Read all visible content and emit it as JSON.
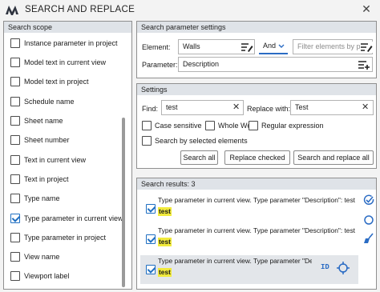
{
  "window": {
    "title": "SEARCH AND REPLACE",
    "close_glyph": "✕"
  },
  "scope": {
    "header": "Search scope",
    "items": [
      {
        "label": "Instance parameter in project",
        "checked": false
      },
      {
        "label": "Model text in current view",
        "checked": false
      },
      {
        "label": "Model text in project",
        "checked": false
      },
      {
        "label": "Schedule name",
        "checked": false
      },
      {
        "label": "Sheet name",
        "checked": false
      },
      {
        "label": "Sheet number",
        "checked": false
      },
      {
        "label": "Text in current view",
        "checked": false
      },
      {
        "label": "Text in project",
        "checked": false
      },
      {
        "label": "Type name",
        "checked": false
      },
      {
        "label": "Type parameter in current view",
        "checked": true
      },
      {
        "label": "Type parameter in project",
        "checked": false
      },
      {
        "label": "View name",
        "checked": false
      },
      {
        "label": "Viewport label",
        "checked": false
      }
    ]
  },
  "params": {
    "header": "Search parameter settings",
    "element_label": "Element:",
    "element_value": "Walls",
    "logic_value": "And",
    "filter_placeholder": "Filter elements by pa",
    "parameter_label": "Parameter:",
    "parameter_value": "Description"
  },
  "settings": {
    "header": "Settings",
    "find_label": "Find:",
    "find_value": "test",
    "replace_label": "Replace with:",
    "replace_value": "Test",
    "case_sensitive": "Case sensitive",
    "whole_word": "Whole Word",
    "regex": "Regular expression",
    "by_selected": "Search by selected elements",
    "search_all": "Search all",
    "replace_checked": "Replace checked",
    "search_and_replace_all": "Search and replace all"
  },
  "results": {
    "header": "Search results: 3",
    "items": [
      {
        "text": "Type parameter in current view. Type parameter \"Description\": test",
        "match": "test",
        "checked": true
      },
      {
        "text": "Type parameter in current view. Type parameter \"Description\": test",
        "match": "test",
        "checked": true
      },
      {
        "text": "Type parameter in current view. Type parameter \"Desc",
        "match": "test",
        "checked": true,
        "id_label": "ID"
      }
    ]
  },
  "colors": {
    "accent": "#2b6cc4",
    "highlight": "#f1ea3c",
    "header_bg": "#dfe3e8"
  }
}
